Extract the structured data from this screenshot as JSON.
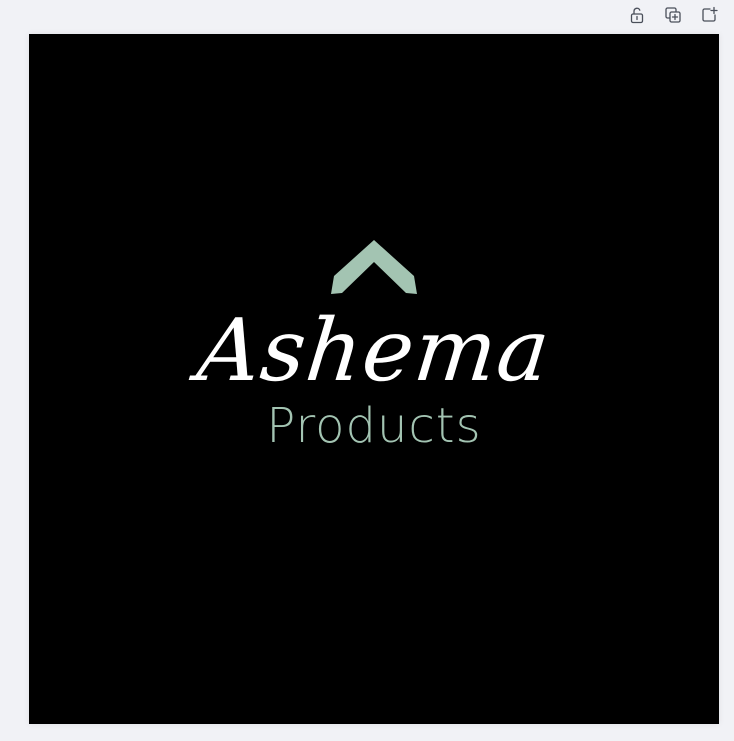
{
  "toolbar": {
    "buttons": [
      {
        "name": "lock-icon"
      },
      {
        "name": "duplicate-page-icon"
      },
      {
        "name": "add-page-icon"
      }
    ]
  },
  "canvas": {
    "background_color": "#000000",
    "logo": {
      "mark": "chevron-up-mark",
      "mark_color": "#a3c4b2",
      "name": "Ashema",
      "name_color": "#ffffff",
      "subtitle": "Products",
      "subtitle_color": "#a3c4b2"
    }
  }
}
